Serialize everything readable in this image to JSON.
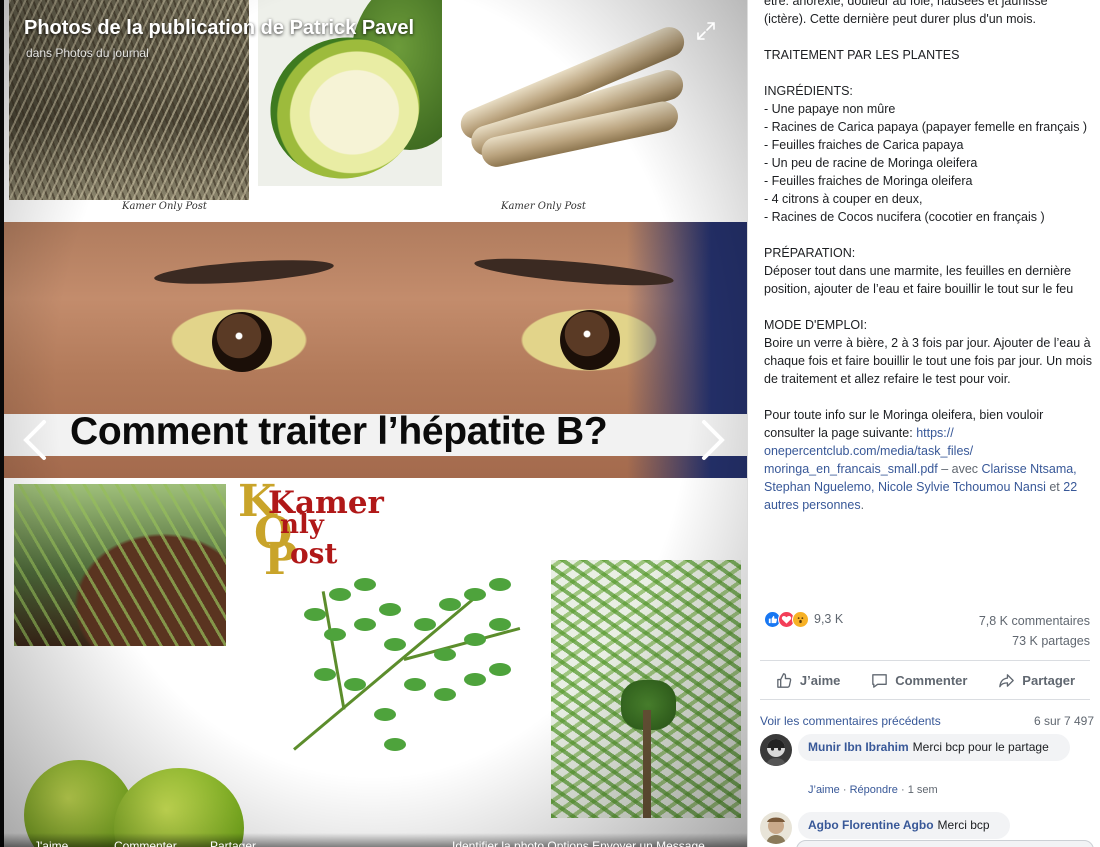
{
  "viewer": {
    "title": "Photos de la publication de Patrick Pavel",
    "subtitle": "dans Photos du journal",
    "image": {
      "caption_left": "Kamer  Only  Post",
      "caption_right": "Kamer  Only  Post",
      "headline": "Comment traiter l’hépatite B?",
      "logo_lines": [
        "Kamer",
        "Only",
        "Post"
      ]
    },
    "bottom_bar": {
      "like": "J'aime",
      "comment": "Commenter",
      "share": "Partager",
      "right_text": "Identifier la photo    Options    Envoyer un Message"
    }
  },
  "post": {
    "intro": "être: anorexie, douleur au foie, nausées et jaunisse (ictère). Cette dernière peut durer plus d'un mois.",
    "section_treatment": "TRAITEMENT PAR LES PLANTES",
    "ingredients": "INGRÉDIENTS:\n- Une papaye non mûre\n- Racines de Carica papaya (papayer femelle en français )\n- Feuilles fraiches de Carica papaya\n- Un peu de racine de Moringa oleifera\n- Feuilles fraiches de Moringa oleifera\n- 4 citrons à couper en deux,\n- Racines de Cocos nucifera (cocotier en français )",
    "preparation": "PRÉPARATION:\nDéposer tout dans une marmite, les feuilles en dernière position, ajouter de l’eau et faire bouillir le tout sur le feu",
    "usage": "MODE D'EMPLOI:\nBoire un verre à bière, 2 à 3 fois par jour. Ajouter de l’eau à chaque fois et faire bouillir le tout une fois par jour. Un mois de traitement et allez refaire le test pour voir.",
    "info_text": "Pour toute info sur le Moringa oleifera, bien vouloir consulter la page suivante: ",
    "link": "https://​onepercentclub.com/media/task_files/​moringa_en_francais_small.pdf",
    "with_text": " – avec ",
    "tagged": "Clarisse Ntsama, Stephan Nguelemo, Nicole Sylvie Tchoumou Nansi",
    "and_text": " et ",
    "others": "22 autres personnes",
    "period": "."
  },
  "stats": {
    "reactions_count": "9,3 K",
    "comments": "7,8 K commentaires",
    "shares": "73 K partages"
  },
  "actions": {
    "like": "J’aime",
    "comment": "Commenter",
    "share": "Partager"
  },
  "comments": {
    "previous_label": "Voir les commentaires précédents",
    "position": "6 sur 7 497",
    "items": [
      {
        "author": "Munir Ibn Ibrahim",
        "text": "Merci bcp pour le partage",
        "like": "J’aime",
        "reply": "Répondre",
        "time": "1 sem"
      },
      {
        "author": "Agbo Florentine Agbo",
        "text": "Merci bcp"
      }
    ]
  },
  "colors": {
    "link": "#385898",
    "like_blue": "#1877f2",
    "love_red": "#f33e58",
    "wow_yellow": "#f7b125"
  }
}
